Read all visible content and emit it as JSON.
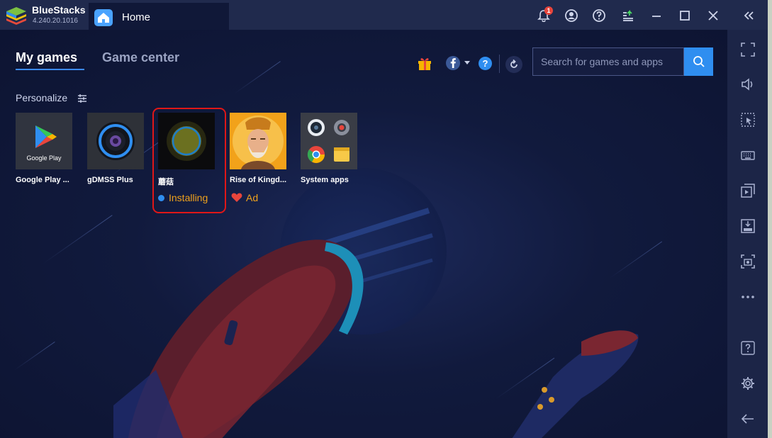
{
  "titlebar": {
    "brand": "BlueStacks",
    "version": "4.240.20.1016",
    "tab_label": "Home",
    "notification_count": "1",
    "icons": [
      "notification-bell-icon",
      "account-icon",
      "help-icon",
      "upload-icon",
      "minimize-icon",
      "maximize-icon",
      "close-icon",
      "collapse-sidebar-icon"
    ]
  },
  "tabs": {
    "active": "My games",
    "inactive": "Game center"
  },
  "section": {
    "personalize": "Personalize"
  },
  "search": {
    "placeholder": "Search for games and apps"
  },
  "toolbar_icons": [
    "gift-icon",
    "facebook-icon",
    "help-icon",
    "refresh-icon",
    "search-icon"
  ],
  "apps": [
    {
      "name": "Google Play ...",
      "tile_text": "Google Play"
    },
    {
      "name": "gDMSS Plus"
    },
    {
      "name": "蘑菇",
      "status": "Installing"
    },
    {
      "name": "Rise of Kingd...",
      "status": "Ad"
    },
    {
      "name": "System apps"
    }
  ],
  "sidebar_icons": [
    "fullscreen-icon",
    "volume-icon",
    "select-area-icon",
    "keyboard-icon",
    "multi-instance-icon",
    "install-apk-icon",
    "screenshot-icon",
    "more-icon",
    "help-icon",
    "settings-icon",
    "back-icon"
  ],
  "colors": {
    "accent": "#2f8ef0",
    "status_text": "#f0a21c",
    "highlight_border": "#e01717",
    "background": "#101838"
  }
}
